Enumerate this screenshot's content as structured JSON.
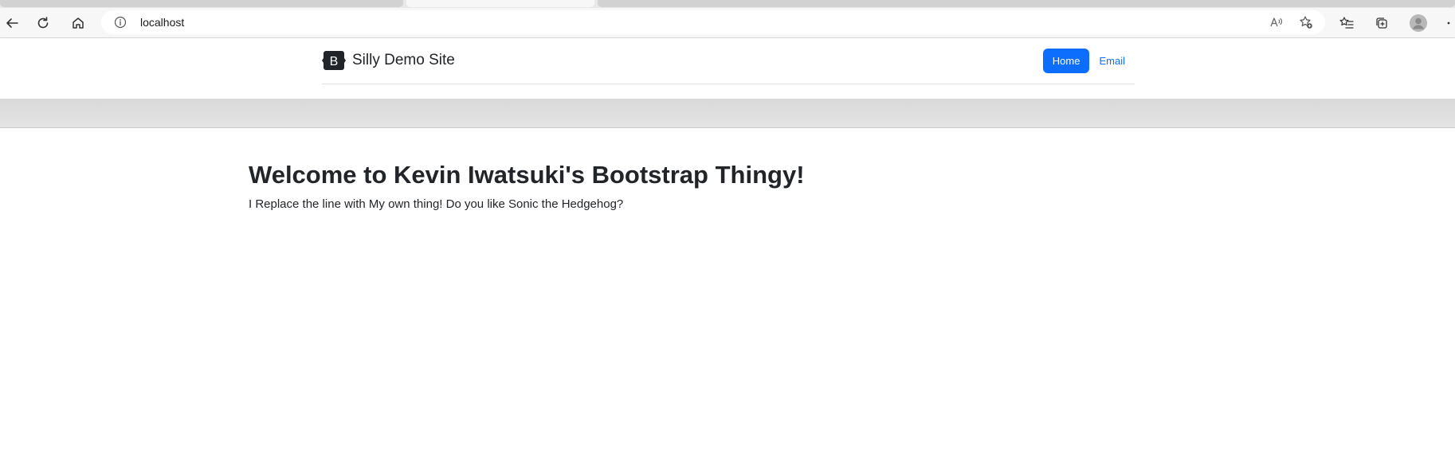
{
  "browser": {
    "url": "localhost"
  },
  "site": {
    "brand_letter": "B",
    "brand_name": "Silly Demo Site",
    "nav": [
      {
        "label": "Home",
        "active": true
      },
      {
        "label": "Email",
        "active": false
      }
    ],
    "accent_color": "#0d6efd"
  },
  "main": {
    "heading": "Welcome to Kevin Iwatsuki's Bootstrap Thingy!",
    "paragraph": "I Replace the line with My own thing! Do you like Sonic the Hedgehog?"
  },
  "icons": {
    "back": "arrow-left-icon",
    "reload": "reload-icon",
    "home": "home-icon",
    "site_info": "info-icon",
    "read_aloud": "read-aloud-icon",
    "add_favorite": "star-add-icon",
    "favorites": "favorites-icon",
    "collections": "collections-icon",
    "profile": "avatar-icon",
    "more": "more-icon"
  }
}
